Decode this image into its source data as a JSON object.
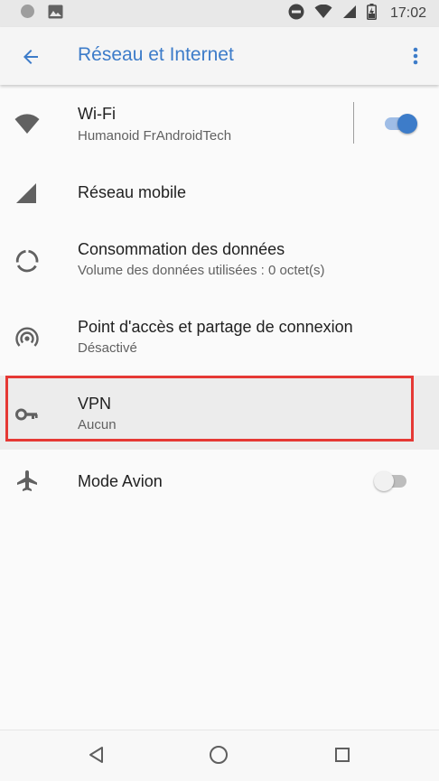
{
  "status_bar": {
    "time": "17:02",
    "icons": [
      "circle-notification-icon",
      "image-notification-icon",
      "do-not-disturb-icon",
      "wifi-signal-icon",
      "cell-signal-icon",
      "battery-icon"
    ]
  },
  "app_bar": {
    "title": "Réseau et Internet",
    "back_icon": "arrow-back-icon",
    "overflow_icon": "more-vert-icon",
    "accent_color": "#3d7cc9"
  },
  "settings": {
    "wifi": {
      "title": "Wi-Fi",
      "subtitle": "Humanoid FrAndroidTech",
      "enabled": true,
      "icon": "wifi-icon"
    },
    "mobile": {
      "title": "Réseau mobile",
      "icon": "mobile-signal-icon"
    },
    "data_usage": {
      "title": "Consommation des données",
      "subtitle": "Volume des données utilisées : 0 octet(s)",
      "icon": "data-usage-icon"
    },
    "hotspot": {
      "title": "Point d'accès et partage de connexion",
      "subtitle": "Désactivé",
      "icon": "hotspot-icon"
    },
    "vpn": {
      "title": "VPN",
      "subtitle": "Aucun",
      "icon": "key-icon",
      "highlighted": true,
      "highlight_color": "#e53935"
    },
    "airplane": {
      "title": "Mode Avion",
      "enabled": false,
      "icon": "airplane-icon"
    }
  },
  "nav_bar": {
    "buttons": [
      "back-triangle-icon",
      "home-circle-icon",
      "recents-square-icon"
    ]
  }
}
